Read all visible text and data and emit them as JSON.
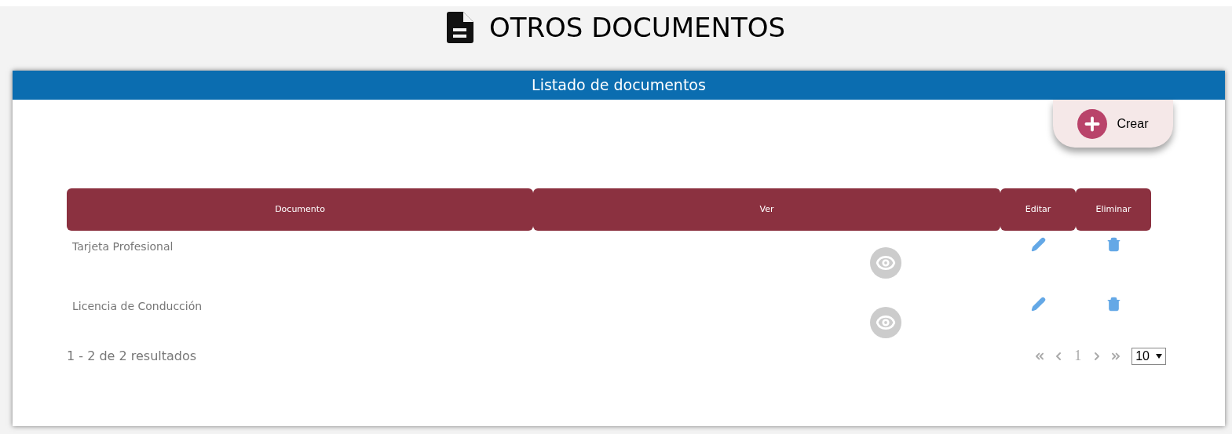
{
  "page_title": "OTROS DOCUMENTOS",
  "panel": {
    "title": "Listado de documentos",
    "create_button": "Crear"
  },
  "table": {
    "columns": [
      "Documento",
      "Ver",
      "Editar",
      "Eliminar"
    ],
    "rows": [
      {
        "document": "Tarjeta Profesional"
      },
      {
        "document": "Licencia de Conducción"
      }
    ]
  },
  "footer": {
    "summary": "1 - 2 de 2 resultados",
    "pages": [
      {
        "label": "1",
        "selected": true
      }
    ],
    "page_size": "10"
  }
}
